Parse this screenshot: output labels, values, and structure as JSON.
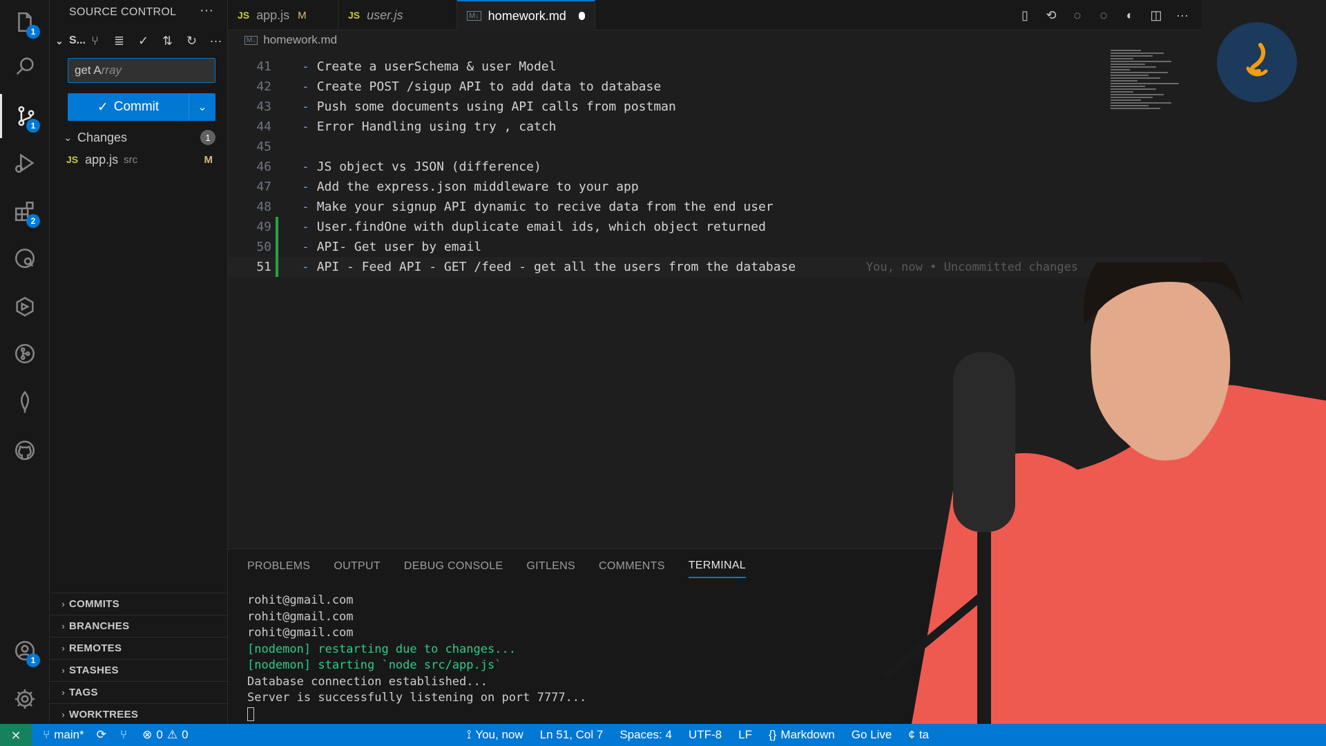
{
  "activity_bar": {
    "items": [
      {
        "icon": "explorer-icon",
        "badge": "1"
      },
      {
        "icon": "search-icon",
        "badge": ""
      },
      {
        "icon": "source-control-icon",
        "badge": "1"
      },
      {
        "icon": "run-debug-icon",
        "badge": ""
      },
      {
        "icon": "extensions-icon",
        "badge": "2"
      },
      {
        "icon": "remote-explorer-icon",
        "badge": ""
      },
      {
        "icon": "gitlens-inspect-icon",
        "badge": ""
      },
      {
        "icon": "gitlens-icon",
        "badge": ""
      },
      {
        "icon": "mongodb-icon",
        "badge": ""
      },
      {
        "icon": "github-icon",
        "badge": ""
      }
    ],
    "account_badge": "1"
  },
  "sidebar": {
    "title": "SOURCE CONTROL",
    "repo_label": "S...",
    "commit_message": "get A",
    "commit_placeholder": "rray",
    "commit_label": "Commit",
    "changes_label": "Changes",
    "changes_count": "1",
    "files": [
      {
        "type": "JS",
        "name": "app.js",
        "dir": "src",
        "status": "M"
      }
    ],
    "sections": [
      "COMMITS",
      "BRANCHES",
      "REMOTES",
      "STASHES",
      "TAGS",
      "WORKTREES"
    ]
  },
  "tabs": [
    {
      "type": "JS",
      "label": "app.js",
      "status": "M"
    },
    {
      "type": "JS",
      "label": "user.js",
      "status": ""
    },
    {
      "type": "M↓",
      "label": "homework.md",
      "status": ""
    }
  ],
  "breadcrumb": {
    "type": "M↓",
    "file": "homework.md"
  },
  "code": {
    "lines": [
      {
        "n": "41",
        "text": "Create a userSchema & user Model"
      },
      {
        "n": "42",
        "text": "Create POST /sigup API to add data to database"
      },
      {
        "n": "43",
        "text": "Push some documents using API calls from postman"
      },
      {
        "n": "44",
        "text": "Error Handling using try , catch"
      },
      {
        "n": "45",
        "text": ""
      },
      {
        "n": "46",
        "text": "JS object vs JSON (difference)"
      },
      {
        "n": "47",
        "text": "Add the express.json middleware to your app"
      },
      {
        "n": "48",
        "text": "Make your signup API dynamic to recive data from the end user"
      },
      {
        "n": "49",
        "text": "User.findOne with duplicate email ids, which object returned"
      },
      {
        "n": "50",
        "text": "API- Get user by email"
      },
      {
        "n": "51",
        "text": "API - Feed API - GET /feed - get all the users from the database"
      }
    ],
    "blame": "You, now • Uncommitted changes"
  },
  "panel": {
    "tabs": [
      "PROBLEMS",
      "OUTPUT",
      "DEBUG CONSOLE",
      "GITLENS",
      "COMMENTS",
      "TERMINAL"
    ],
    "active_tab": "TERMINAL",
    "terminal": [
      {
        "text": "rohit@gmail.com",
        "style": "plain"
      },
      {
        "text": "rohit@gmail.com",
        "style": "plain"
      },
      {
        "text": "rohit@gmail.com",
        "style": "plain"
      },
      {
        "text": "[nodemon] restarting due to changes...",
        "style": "green"
      },
      {
        "text": "[nodemon] starting `node src/app.js`",
        "style": "green"
      },
      {
        "text": "Database connection established...",
        "style": "plain"
      },
      {
        "text": "Server is successfully listening on port 7777...",
        "style": "plain"
      }
    ]
  },
  "status_bar": {
    "branch": "main*",
    "errors": "0",
    "warnings": "0",
    "blame": "You, now",
    "position": "Ln 51, Col 7",
    "spaces": "Spaces: 4",
    "encoding": "UTF-8",
    "eol": "LF",
    "language": "Markdown",
    "go_live": "Go Live",
    "extra": "ta"
  },
  "colors": {
    "accent": "#0078d4",
    "status_bar": "#0078d4",
    "remote": "#16825d",
    "modified": "#d7ba7d",
    "git_added": "#2ea043",
    "terminal_green": "#23d18b"
  }
}
